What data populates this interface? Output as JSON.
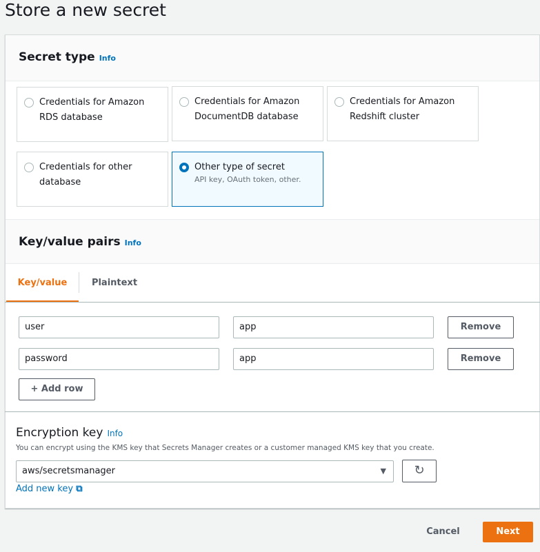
{
  "page": {
    "title": "Store a new secret"
  },
  "secret_type": {
    "title": "Secret type",
    "info": "Info",
    "options": [
      {
        "label": "Credentials for Amazon RDS database",
        "selected": false
      },
      {
        "label": "Credentials for Amazon DocumentDB database",
        "selected": false
      },
      {
        "label": "Credentials for Amazon Redshift cluster",
        "selected": false
      },
      {
        "label": "Credentials for other database",
        "selected": false
      },
      {
        "label": "Other type of secret",
        "description": "API key, OAuth token, other.",
        "selected": true
      }
    ]
  },
  "kv": {
    "title": "Key/value pairs",
    "info": "Info",
    "tabs": [
      {
        "label": "Key/value",
        "active": true
      },
      {
        "label": "Plaintext",
        "active": false
      }
    ],
    "rows": [
      {
        "key": "user",
        "value": "app",
        "remove": "Remove"
      },
      {
        "key": "password",
        "value": "app",
        "remove": "Remove"
      }
    ],
    "add_row": "+ Add row"
  },
  "encryption": {
    "title": "Encryption key",
    "info": "Info",
    "description": "You can encrypt using the KMS key that Secrets Manager creates or a customer managed KMS key that you create.",
    "selected": "aws/secretsmanager",
    "add_key": "Add new key"
  },
  "footer": {
    "cancel": "Cancel",
    "next": "Next"
  },
  "colors": {
    "accent": "#ec7211",
    "link": "#0073bb"
  }
}
